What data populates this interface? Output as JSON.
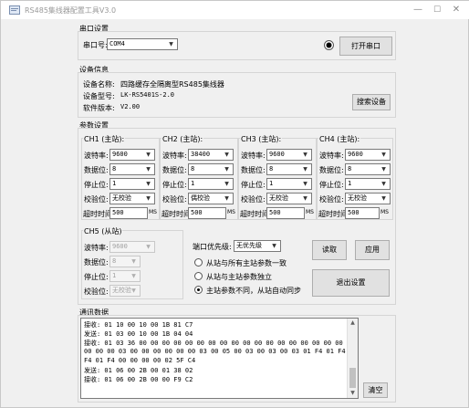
{
  "window": {
    "title": "RS485集线器配置工具V3.0",
    "min": "—",
    "max": "☐",
    "close": "✕"
  },
  "serial": {
    "section": "串口设置",
    "port_label": "串口号:",
    "port_value": "COM4",
    "open_button": "打开串口"
  },
  "device": {
    "section": "设备信息",
    "name_label": "设备名称:",
    "name_value": "四路缓存全隔离型RS485集线器",
    "model_label": "设备型号:",
    "model_value": "LK-RS5401S-2.0",
    "version_label": "软件版本:",
    "version_value": "V2.00",
    "search_button": "搜索设备"
  },
  "params": {
    "section": "参数设置",
    "labels": {
      "baud": "波特率:",
      "data": "数据位:",
      "stop": "停止位:",
      "parity": "校验位:",
      "timeout": "超时时间:",
      "ms": "MS"
    },
    "channels": [
      {
        "title": "CH1 (主站):",
        "baud": "9600",
        "data": "8",
        "stop": "1",
        "parity": "无校验",
        "timeout": "500"
      },
      {
        "title": "CH2 (主站):",
        "baud": "38400",
        "data": "8",
        "stop": "1",
        "parity": "偶校验",
        "timeout": "500"
      },
      {
        "title": "CH3 (主站):",
        "baud": "9600",
        "data": "8",
        "stop": "1",
        "parity": "无校验",
        "timeout": "500"
      },
      {
        "title": "CH4 (主站):",
        "baud": "9600",
        "data": "8",
        "stop": "1",
        "parity": "无校验",
        "timeout": "500"
      }
    ],
    "ch5": {
      "title": "CH5 (从站)",
      "baud": "9600",
      "data": "8",
      "stop": "1",
      "parity": "无校验"
    },
    "priority_label": "端口优先级:",
    "priority_value": "无优先级",
    "radios": [
      {
        "label": "从站与所有主站参数一致",
        "checked": false
      },
      {
        "label": "从站与主站参数独立",
        "checked": false
      },
      {
        "label": "主站参数不同，从站自动同步",
        "checked": true
      }
    ],
    "read_button": "读取",
    "apply_button": "应用",
    "exit_button": "退出设置"
  },
  "comm": {
    "section": "通讯数据",
    "lines": [
      "接收: 01 10 00 10 00 1B 81 C7",
      "发送: 01 03 00 10 00 1B 04 04",
      "接收: 01 03 36 00 00 00 00 00 00 00 00 00 00 00 00 00 00 00 00 00 00 00 00 00 00",
      "00 00 00 03 00 00 00 00 00 00 03 00 05 00 03 00 03 00 03 01 F4 01 F4 01 F4 01",
      "F4 01 F4 00 00 00 00 02 5F C4",
      "发送: 01 06 00 2B 00 01 38 02",
      "接收: 01 06 00 2B 00 00 F9 C2"
    ],
    "clear_button": "清空"
  }
}
